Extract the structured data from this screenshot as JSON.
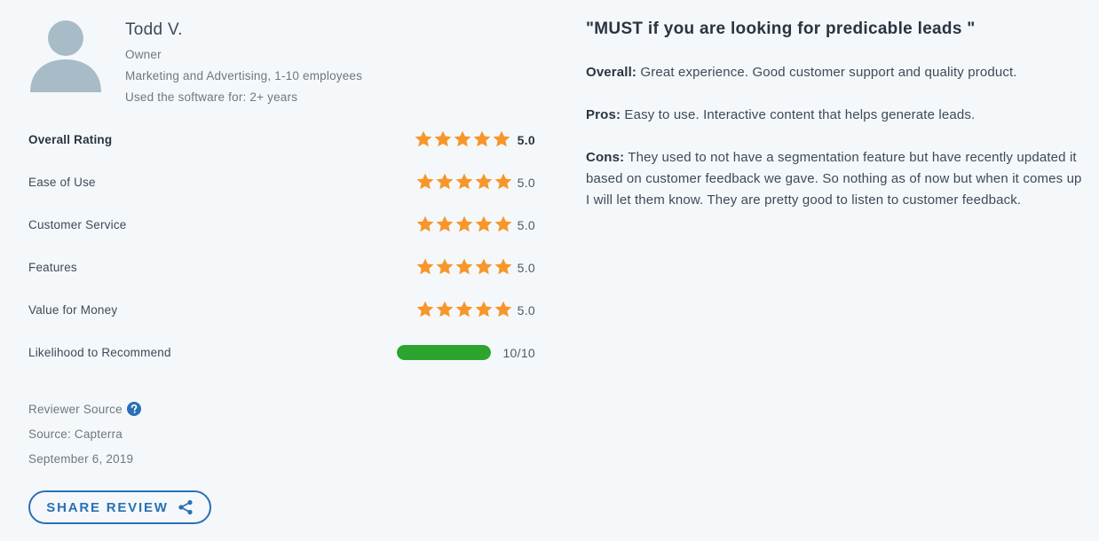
{
  "reviewer": {
    "name": "Todd V.",
    "role": "Owner",
    "company": "Marketing and Advertising, 1-10 employees",
    "usage": "Used the software for: 2+ years"
  },
  "ratings": [
    {
      "label": "Overall Rating",
      "value": "5.0",
      "stars": 5
    },
    {
      "label": "Ease of Use",
      "value": "5.0",
      "stars": 5
    },
    {
      "label": "Customer Service",
      "value": "5.0",
      "stars": 5
    },
    {
      "label": "Features",
      "value": "5.0",
      "stars": 5
    },
    {
      "label": "Value for Money",
      "value": "5.0",
      "stars": 5
    }
  ],
  "recommend": {
    "label": "Likelihood to Recommend",
    "value": "10/10",
    "fraction": 1.0
  },
  "source": {
    "reviewer_source_label": "Reviewer Source",
    "source_text": "Source: Capterra",
    "date": "September 6, 2019"
  },
  "share": {
    "label": "SHARE REVIEW"
  },
  "review": {
    "title": "\"MUST if you are looking for predicable leads \"",
    "overall_label": "Overall:",
    "overall_text": "Great experience. Good customer support and quality product.",
    "pros_label": "Pros:",
    "pros_text": "Easy to use. Interactive content that helps generate leads.",
    "cons_label": "Cons:",
    "cons_text": "They used to not have a segmentation feature but have recently updated it based on customer feedback we gave. So nothing as of now but when it comes up I will let them know. They are pretty good to listen to customer feedback."
  },
  "colors": {
    "star": "#f7962a",
    "recommend_bar": "#2ba52d",
    "accent": "#2a6fb6",
    "avatar": "#a8bcc8"
  },
  "icons": {
    "avatar": "person-silhouette-icon",
    "star": "star-icon",
    "help": "question-mark-icon",
    "share": "share-icon"
  }
}
